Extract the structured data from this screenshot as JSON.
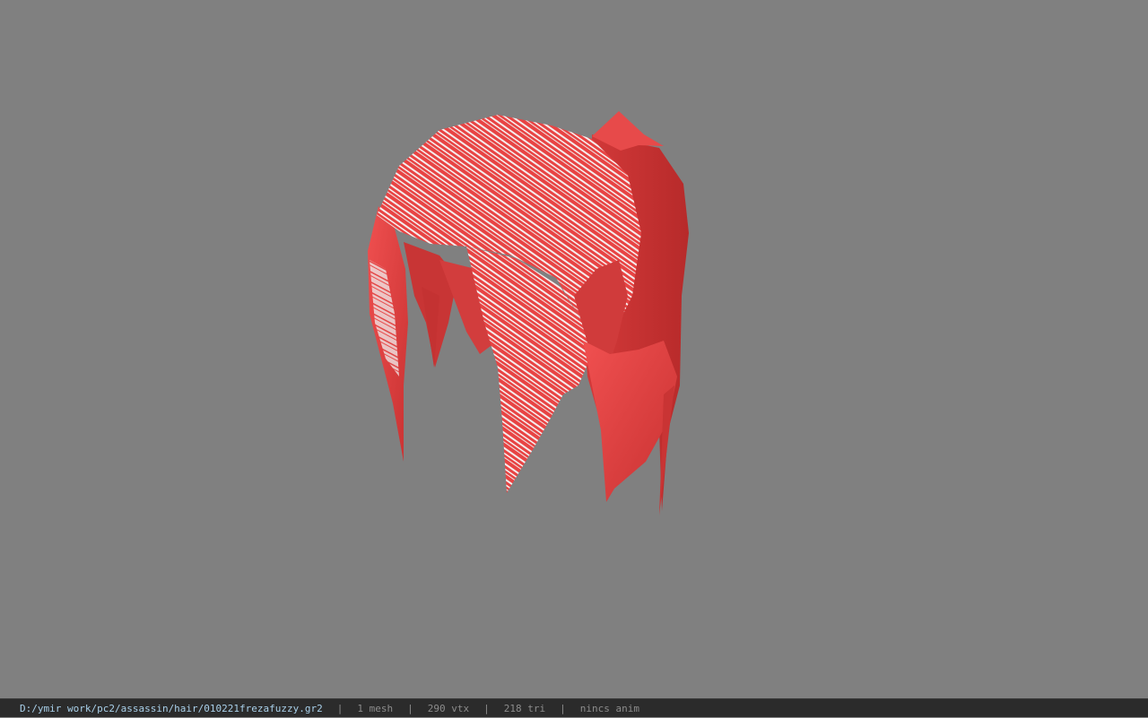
{
  "viewport": {
    "background_color": "#808080",
    "model": {
      "description_icon": "hair-mesh-3d",
      "primary_color": "#e84a4a",
      "highlight_color": "#f2f2f2"
    }
  },
  "status_bar": {
    "file_path": "D:/ymir work/pc2/assassin/hair/010221frezafuzzy.gr2",
    "separator": "|",
    "mesh_count": "1 mesh",
    "vertex_count": "290 vtx",
    "triangle_count": "218 tri",
    "anim_status": "nincs anim"
  }
}
